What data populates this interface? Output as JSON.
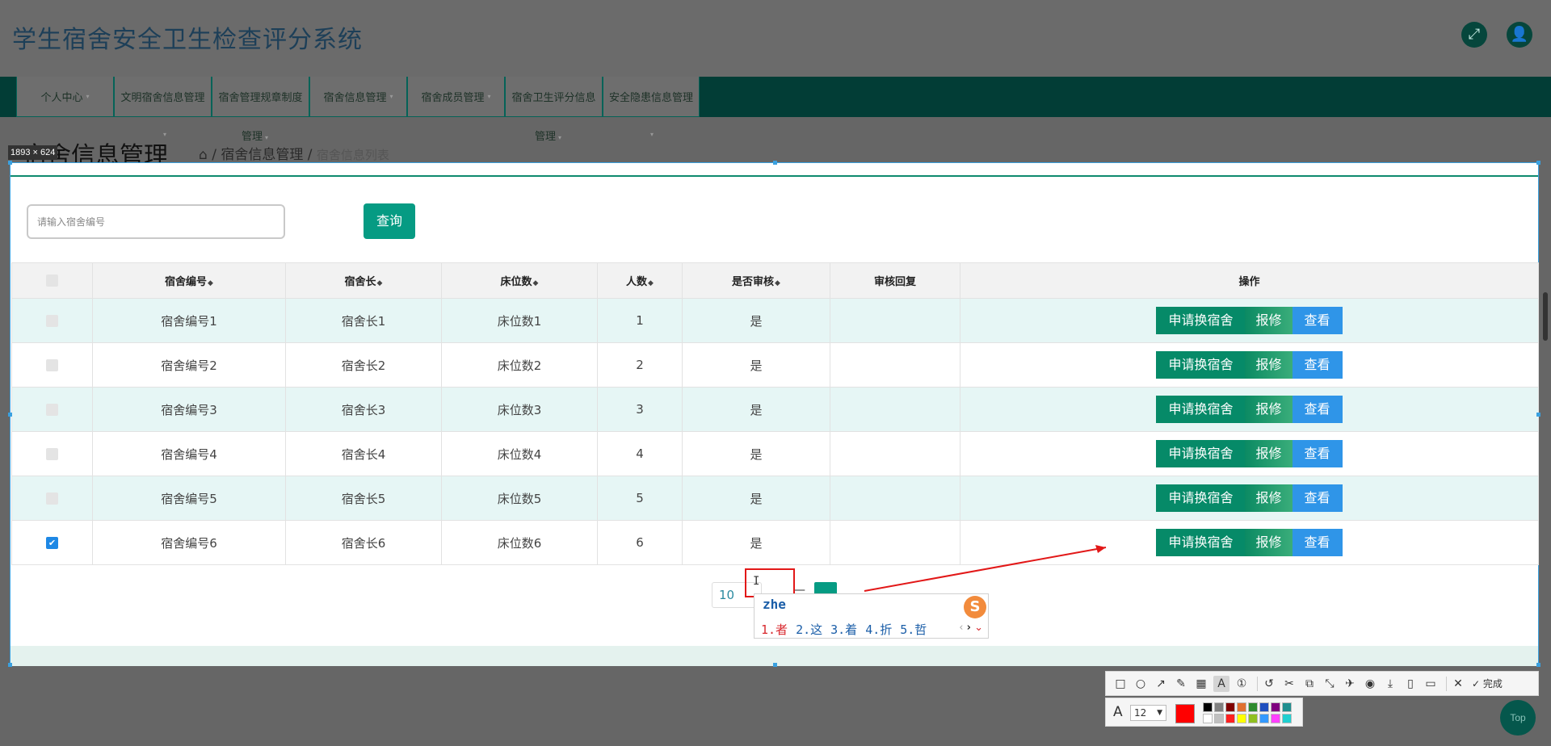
{
  "app": {
    "title": "学生宿舍安全卫生检查评分系统",
    "fullscreen_icon": "expand-icon",
    "user_icon": "user-icon"
  },
  "nav": {
    "items": [
      {
        "label": "个人中心",
        "has_caret": true
      },
      {
        "label": "文明宿舍信息管理"
      },
      {
        "label": "宿舍管理规章制度"
      },
      {
        "label": "宿舍信息管理",
        "has_caret": true
      },
      {
        "label": "宿舍成员管理",
        "has_caret": true
      },
      {
        "label": "宿舍卫生评分信息"
      },
      {
        "label": "安全隐患信息管理"
      }
    ],
    "subs": [
      "管理",
      "管理"
    ]
  },
  "page": {
    "heading": "宿舍信息管理",
    "breadcrumb_parent": "宿舍信息管理",
    "breadcrumb_current": "宿舍信息列表"
  },
  "capture": {
    "size_label": "1893 × 624"
  },
  "search": {
    "placeholder": "请输入宿舍编号",
    "button": "查询"
  },
  "table": {
    "headers": [
      "宿舍编号",
      "宿舍长",
      "床位数",
      "人数",
      "是否审核",
      "审核回复",
      "操作"
    ],
    "rows": [
      {
        "id": "宿舍编号1",
        "leader": "宿舍长1",
        "beds": "床位数1",
        "count": "1",
        "audited": "是",
        "reply": "",
        "checked": false
      },
      {
        "id": "宿舍编号2",
        "leader": "宿舍长2",
        "beds": "床位数2",
        "count": "2",
        "audited": "是",
        "reply": "",
        "checked": false
      },
      {
        "id": "宿舍编号3",
        "leader": "宿舍长3",
        "beds": "床位数3",
        "count": "3",
        "audited": "是",
        "reply": "",
        "checked": false
      },
      {
        "id": "宿舍编号4",
        "leader": "宿舍长4",
        "beds": "床位数4",
        "count": "4",
        "audited": "是",
        "reply": "",
        "checked": false
      },
      {
        "id": "宿舍编号5",
        "leader": "宿舍长5",
        "beds": "床位数5",
        "count": "5",
        "audited": "是",
        "reply": "",
        "checked": false
      },
      {
        "id": "宿舍编号6",
        "leader": "宿舍长6",
        "beds": "床位数6",
        "count": "6",
        "audited": "是",
        "reply": "",
        "checked": true
      }
    ],
    "actions": {
      "swap": "申请换宿舍",
      "repair": "报修",
      "view": "查看"
    }
  },
  "pager": {
    "page_size": "10"
  },
  "ime": {
    "input": "zhe",
    "candidates": [
      "1.者",
      "2.这",
      "3.着",
      "4.折",
      "5.哲"
    ],
    "logo": "S"
  },
  "toolbar": {
    "tools": [
      "rect-icon",
      "ellipse-icon",
      "arrow-icon",
      "pen-icon",
      "mosaic-icon",
      "text-icon",
      "number-icon",
      "undo-icon",
      "ocr-icon",
      "translate-icon",
      "scroll-capture-icon",
      "pin-icon",
      "record-icon",
      "save-icon",
      "long-capture-icon",
      "bookmark-icon",
      "close-icon"
    ],
    "done_label": "完成",
    "font_size": "12",
    "current_color": "#ff0000",
    "palette": [
      "#000000",
      "#808080",
      "#800000",
      "#e07030",
      "#2e8b2e",
      "#1f4fbf",
      "#800080",
      "#1f8f8f",
      "#ffffff",
      "#c0c0c0",
      "#ff2020",
      "#ffff00",
      "#90c020",
      "#3399ff",
      "#ff40ff",
      "#20d0d0"
    ]
  },
  "top_button": "Top"
}
